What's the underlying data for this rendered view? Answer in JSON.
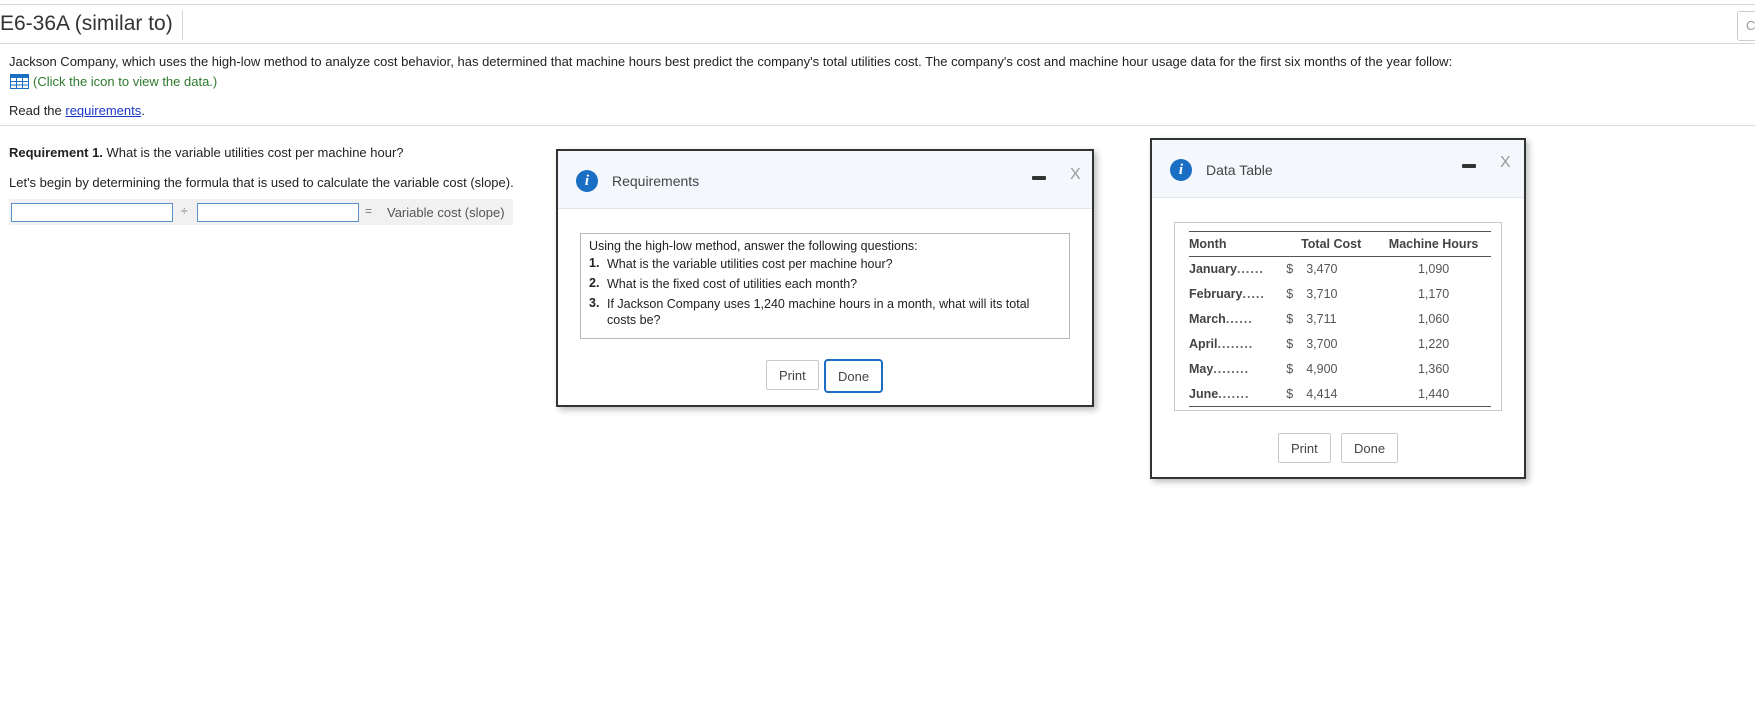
{
  "header": {
    "title": "E6-36A (similar to)",
    "tool_icon": "C"
  },
  "problem": {
    "intro": "Jackson Company, which uses the high-low method to analyze cost behavior, has determined that machine hours best predict the company's total utilities cost. The company's cost and machine hour usage data for the first six months of the year follow:",
    "data_link": "(Click the icon to view the data.)",
    "read_prefix": "Read the ",
    "read_link": "requirements",
    "read_suffix": "."
  },
  "requirement1": {
    "label": "Requirement 1.",
    "question": " What is the variable utilities cost per machine hour?",
    "begin": "Let's begin by determining the formula that is used to calculate the variable cost (slope).",
    "formula": {
      "input1_value": "",
      "operator": "÷",
      "input2_value": "",
      "equals": "=",
      "result_label": "Variable cost (slope)"
    }
  },
  "requirements_dialog": {
    "title": "Requirements",
    "minimize": "—",
    "close": "X",
    "intro": "Using the high-low method, answer the following questions:",
    "items": [
      {
        "num": "1.",
        "text": "What is the variable utilities cost per machine hour?"
      },
      {
        "num": "2.",
        "text": "What is the fixed cost of utilities each month?"
      },
      {
        "num": "3.",
        "text": "If Jackson Company uses 1,240 machine hours in a month, what will its total costs be?"
      }
    ],
    "print": "Print",
    "done": "Done"
  },
  "data_dialog": {
    "title": "Data Table",
    "minimize": "—",
    "close": "X",
    "columns": {
      "month": "Month",
      "total_cost": "Total Cost",
      "machine_hours": "Machine Hours"
    },
    "rows": [
      {
        "month": "January",
        "dots": "......",
        "dollar": "$",
        "cost": "3,470",
        "hours": "1,090"
      },
      {
        "month": "February",
        "dots": ".....",
        "dollar": "$",
        "cost": "3,710",
        "hours": "1,170"
      },
      {
        "month": "March",
        "dots": "......",
        "dollar": "$",
        "cost": "3,711",
        "hours": "1,060"
      },
      {
        "month": "April",
        "dots": "........",
        "dollar": "$",
        "cost": "3,700",
        "hours": "1,220"
      },
      {
        "month": "May",
        "dots": "........",
        "dollar": "$",
        "cost": "4,900",
        "hours": "1,360"
      },
      {
        "month": "June",
        "dots": ".......",
        "dollar": "$",
        "cost": "4,414",
        "hours": "1,440"
      }
    ],
    "print": "Print",
    "done": "Done"
  },
  "colors": {
    "link": "#1a37c4",
    "data_link": "#2d7a2d",
    "info_icon": "#1a6fc4",
    "input_border": "#5a8fc9"
  },
  "icons": [
    "table-grid-icon",
    "info-icon",
    "minimize-icon",
    "close-icon"
  ]
}
